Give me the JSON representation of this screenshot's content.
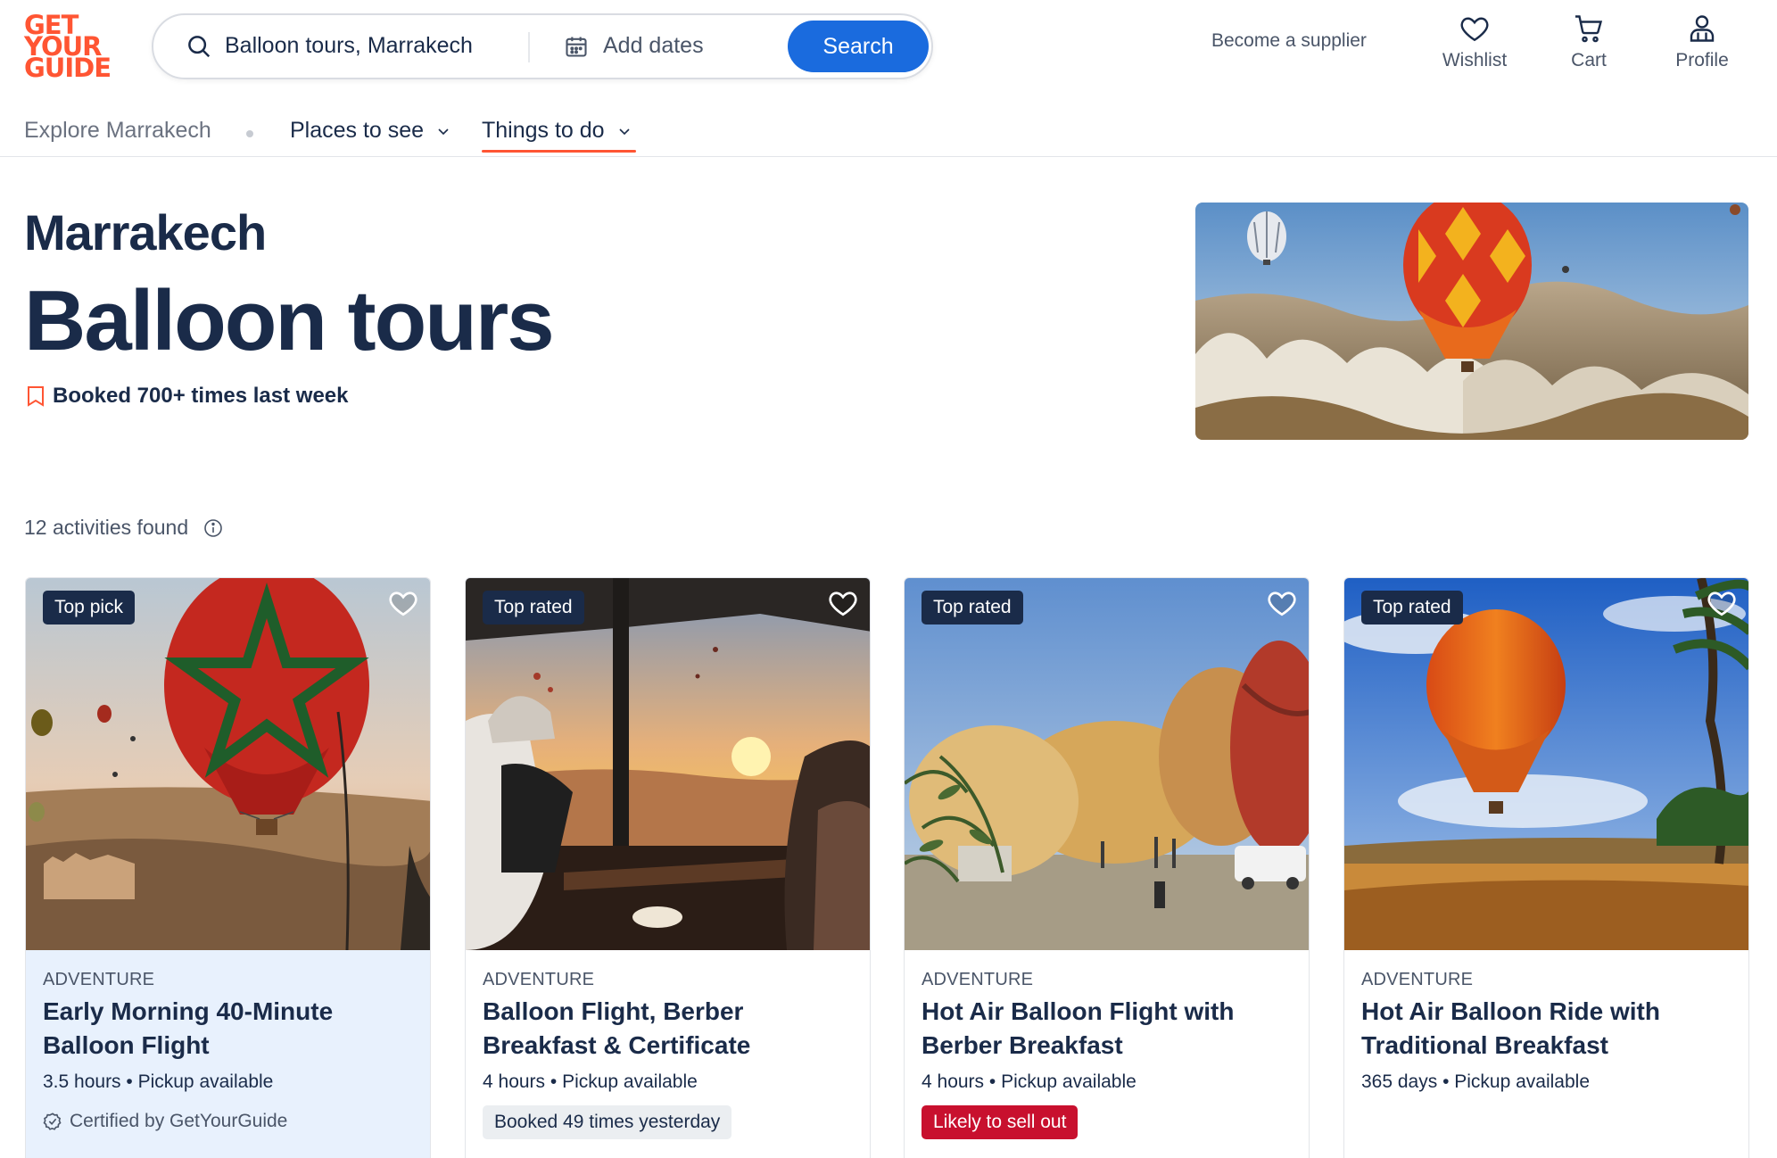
{
  "logo": {
    "line1": "GET",
    "line2": "YOUR",
    "line3": "GUIDE",
    "color": "#ff5533"
  },
  "search": {
    "location": "Balloon tours, Marrakech",
    "dates_placeholder": "Add dates",
    "button_label": "Search",
    "button_color": "#1a6bde"
  },
  "header": {
    "become_supplier": "Become a supplier",
    "wishlist": "Wishlist",
    "cart": "Cart",
    "profile": "Profile"
  },
  "subnav": {
    "explore": "Explore Marrakech",
    "places": "Places to see",
    "things": "Things to do",
    "active": "Things to do"
  },
  "hero": {
    "city": "Marrakech",
    "title": "Balloon tours",
    "booked": "Booked 700+ times last week"
  },
  "results": {
    "count_text": "12 activities found"
  },
  "cards": [
    {
      "badge": "Top pick",
      "category": "ADVENTURE",
      "title": "Early Morning 40-Minute Balloon Flight",
      "meta": "3.5 hours • Pickup available",
      "footer": "Certified by GetYourGuide"
    },
    {
      "badge": "Top rated",
      "category": "ADVENTURE",
      "title": "Balloon Flight, Berber Breakfast & Certificate",
      "meta": "4 hours • Pickup available",
      "footer": "Booked 49 times yesterday"
    },
    {
      "badge": "Top rated",
      "category": "ADVENTURE",
      "title": "Hot Air Balloon Flight with Berber Breakfast",
      "meta": "4 hours • Pickup available",
      "footer": "Likely to sell out"
    },
    {
      "badge": "Top rated",
      "category": "ADVENTURE",
      "title": "Hot Air Balloon Ride with Traditional Breakfast",
      "meta": "365 days • Pickup available",
      "footer": ""
    }
  ],
  "colors": {
    "navy": "#1a2b49",
    "accent": "#ff5533",
    "sellout": "#c8102e",
    "highlight": "#e8f1fd"
  }
}
